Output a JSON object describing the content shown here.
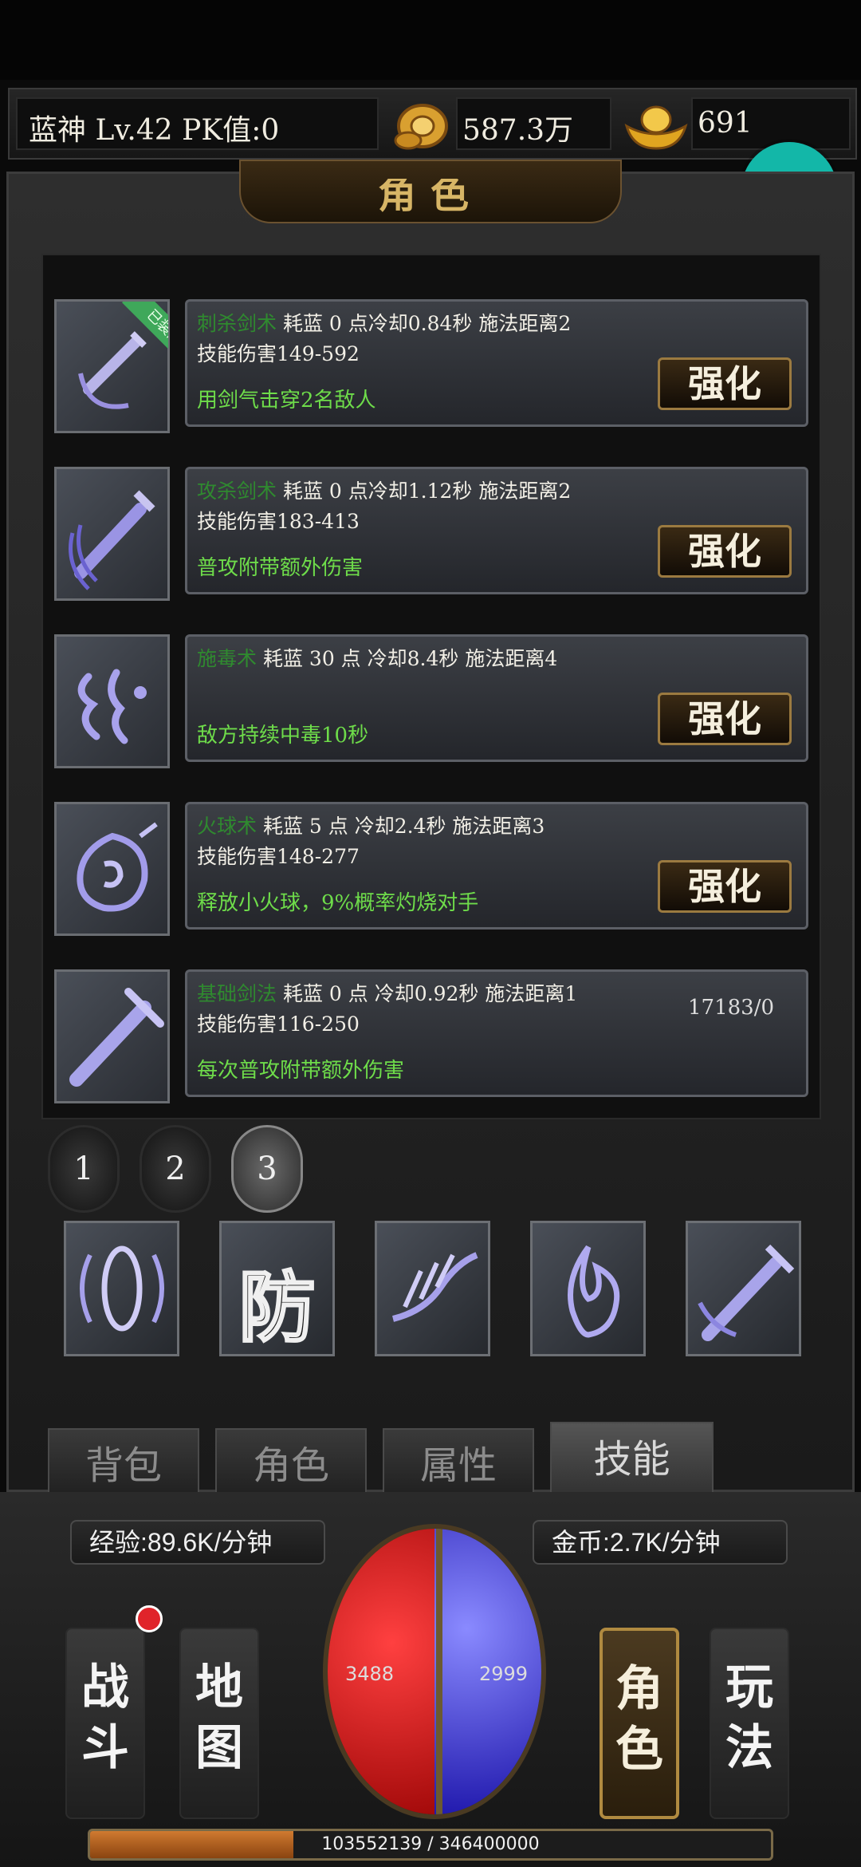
{
  "hud": {
    "player": "蓝神  Lv.42 PK值:0",
    "gold": "587.3万",
    "ingots": "691"
  },
  "panel": {
    "title": "角色"
  },
  "skills": [
    {
      "name": "刺杀剑术",
      "stats": "耗蓝 0 点冷却0.84秒  施法距离2",
      "damage": "技能伤害149-592",
      "desc": "用剑气击穿2名敌人",
      "button": "强化",
      "badge": "已装配"
    },
    {
      "name": "攻杀剑术",
      "stats": "耗蓝 0 点冷却1.12秒  施法距离2",
      "damage": "技能伤害183-413",
      "desc": "普攻附带额外伤害",
      "button": "强化"
    },
    {
      "name": "施毒术",
      "stats": "耗蓝 30 点  冷却8.4秒 施法距离4",
      "damage": "",
      "desc": "敌方持续中毒10秒",
      "button": "强化"
    },
    {
      "name": "火球术",
      "stats": "耗蓝 5 点     冷却2.4秒 施法距离3",
      "damage": "技能伤害148-277",
      "desc": "释放小火球，9%概率灼烧对手",
      "button": "强化"
    },
    {
      "name": "基础剑法",
      "stats": "耗蓝 0 点 冷却0.92秒  施法距离1",
      "damage": "技能伤害116-250",
      "desc": "每次普攻附带额外伤害",
      "count": "17183/0"
    }
  ],
  "pages": [
    "1",
    "2",
    "3"
  ],
  "quickslots": [
    "shield-ring-icon",
    "defense-icon",
    "wave-claw-icon",
    "flame-icon",
    "sword-icon"
  ],
  "quickslot_text": {
    "defense": "防"
  },
  "tabs": [
    "背包",
    "角色",
    "属性",
    "技能"
  ],
  "rates": {
    "exp": "经验:89.6K/分钟",
    "gold": "金币:2.7K/分钟"
  },
  "nav": {
    "battle": "战斗",
    "map": "地图",
    "role": "角色",
    "play": "玩法"
  },
  "orb": {
    "hp": "3488",
    "mp": "2999"
  },
  "exp_bar": {
    "text": "103552139 / 346400000",
    "progress": 0.299
  },
  "colors": {
    "accent_gold": "#b08a40",
    "hp_red": "#e02020",
    "mp_blue": "#3a2ee0",
    "skill_green": "#6edc4a"
  }
}
